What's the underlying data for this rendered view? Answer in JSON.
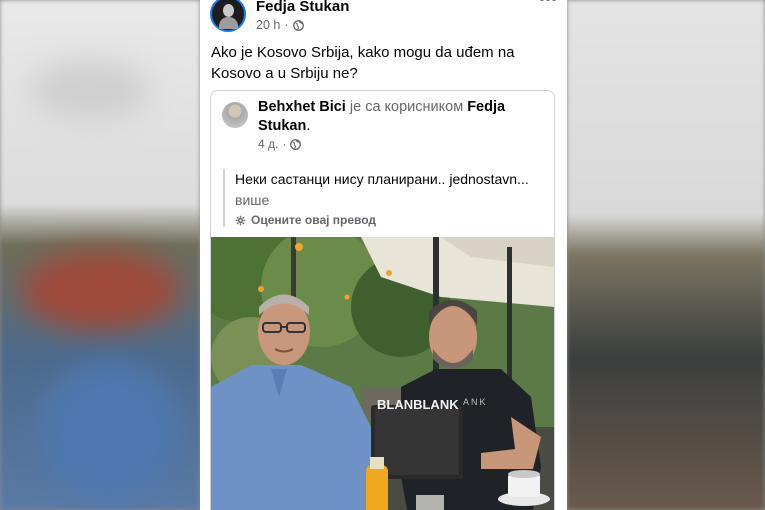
{
  "post": {
    "author": "Fedja Stukan",
    "time": "20 h",
    "dot": "·",
    "more_icon": "more-horizontal-icon",
    "text": "Ako je Kosovo Srbija, kako mogu da uđem na Kosovo a u Srbiju ne?"
  },
  "shared": {
    "author": "Behxhet Bici",
    "with_text": "је са корисником",
    "tagged": "Fedja Stukan",
    "period": ".",
    "time": "4 д.",
    "dot": "·",
    "quote": "Неки састанци нису планирани.. jednostavn...",
    "see_more": "више",
    "translate": "Оцените овај превод",
    "photo_text": "BLANBLANK",
    "shirt_text": "ANK"
  },
  "colors": {
    "accent": "#1877f2",
    "text": "#050505",
    "secondary": "#65676b"
  }
}
